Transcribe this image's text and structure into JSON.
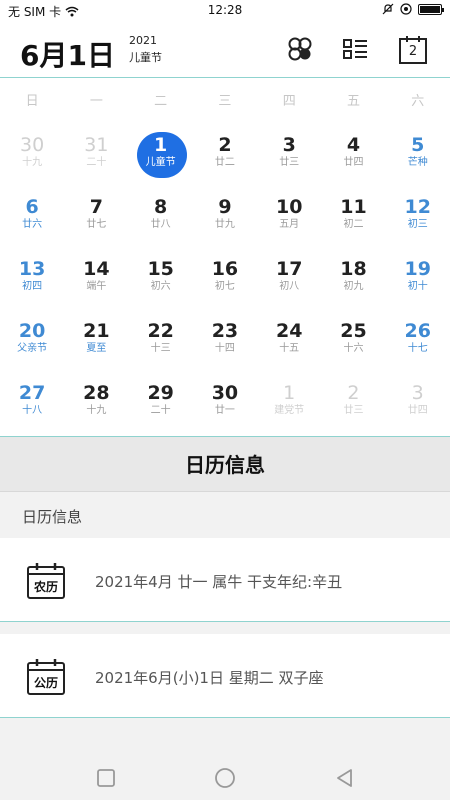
{
  "status": {
    "carrier": "无 SIM 卡",
    "time": "12:28",
    "battery_level": 1.0
  },
  "header": {
    "date": "6月1日",
    "year": "2021",
    "festival": "儿童节",
    "today_icon_number": "2"
  },
  "weekdays": [
    "日",
    "一",
    "二",
    "三",
    "四",
    "五",
    "六"
  ],
  "calendar": {
    "weeks": [
      [
        {
          "num": "30",
          "sub": "十九",
          "state": "dim"
        },
        {
          "num": "31",
          "sub": "二十",
          "state": "dim"
        },
        {
          "num": "1",
          "sub": "儿童节",
          "state": "selected"
        },
        {
          "num": "2",
          "sub": "廿二",
          "state": "normal"
        },
        {
          "num": "3",
          "sub": "廿三",
          "state": "normal"
        },
        {
          "num": "4",
          "sub": "廿四",
          "state": "normal"
        },
        {
          "num": "5",
          "sub": "芒种",
          "state": "weekend"
        }
      ],
      [
        {
          "num": "6",
          "sub": "廿六",
          "state": "weekend"
        },
        {
          "num": "7",
          "sub": "廿七",
          "state": "normal"
        },
        {
          "num": "8",
          "sub": "廿八",
          "state": "normal"
        },
        {
          "num": "9",
          "sub": "廿九",
          "state": "normal"
        },
        {
          "num": "10",
          "sub": "五月",
          "state": "normal"
        },
        {
          "num": "11",
          "sub": "初二",
          "state": "normal"
        },
        {
          "num": "12",
          "sub": "初三",
          "state": "weekend"
        }
      ],
      [
        {
          "num": "13",
          "sub": "初四",
          "state": "weekend"
        },
        {
          "num": "14",
          "sub": "端午",
          "state": "normal"
        },
        {
          "num": "15",
          "sub": "初六",
          "state": "normal"
        },
        {
          "num": "16",
          "sub": "初七",
          "state": "normal"
        },
        {
          "num": "17",
          "sub": "初八",
          "state": "normal"
        },
        {
          "num": "18",
          "sub": "初九",
          "state": "normal"
        },
        {
          "num": "19",
          "sub": "初十",
          "state": "weekend"
        }
      ],
      [
        {
          "num": "20",
          "sub": "父亲节",
          "state": "weekend"
        },
        {
          "num": "21",
          "sub": "夏至",
          "state": "holiday"
        },
        {
          "num": "22",
          "sub": "十三",
          "state": "normal"
        },
        {
          "num": "23",
          "sub": "十四",
          "state": "normal"
        },
        {
          "num": "24",
          "sub": "十五",
          "state": "normal"
        },
        {
          "num": "25",
          "sub": "十六",
          "state": "normal"
        },
        {
          "num": "26",
          "sub": "十七",
          "state": "weekend"
        }
      ],
      [
        {
          "num": "27",
          "sub": "十八",
          "state": "weekend"
        },
        {
          "num": "28",
          "sub": "十九",
          "state": "normal"
        },
        {
          "num": "29",
          "sub": "二十",
          "state": "normal"
        },
        {
          "num": "30",
          "sub": "廿一",
          "state": "normal"
        },
        {
          "num": "1",
          "sub": "建党节",
          "state": "dim"
        },
        {
          "num": "2",
          "sub": "廿三",
          "state": "dim"
        },
        {
          "num": "3",
          "sub": "廿四",
          "state": "dim"
        }
      ]
    ]
  },
  "section": {
    "title": "日历信息",
    "label": "日历信息"
  },
  "info": [
    {
      "icon_label": "农历",
      "text": "2021年4月 廿一 属牛 干支年纪:辛丑"
    },
    {
      "icon_label": "公历",
      "text": "2021年6月(小)1日 星期二 双子座"
    }
  ],
  "colors": {
    "accent": "#1f6fe3",
    "weekend": "#3f8ad3",
    "divider": "#8fd3cf"
  }
}
